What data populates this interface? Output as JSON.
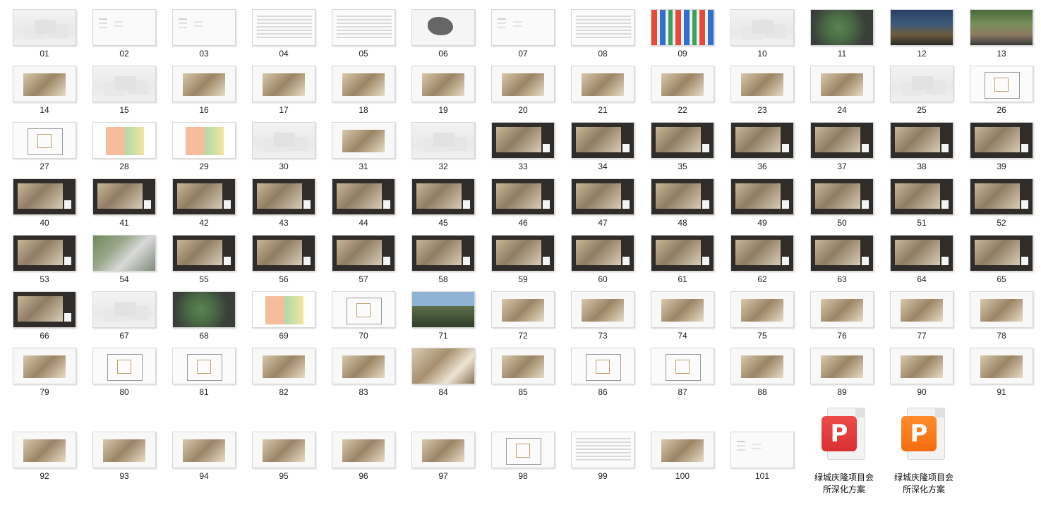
{
  "thumbnails": [
    {
      "label": "01",
      "style": "fog"
    },
    {
      "label": "02",
      "style": "white"
    },
    {
      "label": "03",
      "style": "white"
    },
    {
      "label": "04",
      "style": "text"
    },
    {
      "label": "05",
      "style": "text"
    },
    {
      "label": "06",
      "style": "map"
    },
    {
      "label": "07",
      "style": "white"
    },
    {
      "label": "08",
      "style": "text"
    },
    {
      "label": "09",
      "style": "logos"
    },
    {
      "label": "10",
      "style": "fog"
    },
    {
      "label": "11",
      "style": "aerial"
    },
    {
      "label": "12",
      "style": "night"
    },
    {
      "label": "13",
      "style": "court"
    },
    {
      "label": "14",
      "style": "photo-light"
    },
    {
      "label": "15",
      "style": "fog"
    },
    {
      "label": "16",
      "style": "photo-light"
    },
    {
      "label": "17",
      "style": "photo-light"
    },
    {
      "label": "18",
      "style": "photo-light"
    },
    {
      "label": "19",
      "style": "photo-light"
    },
    {
      "label": "20",
      "style": "photo-light"
    },
    {
      "label": "21",
      "style": "photo-light"
    },
    {
      "label": "22",
      "style": "photo-light"
    },
    {
      "label": "23",
      "style": "photo-light"
    },
    {
      "label": "24",
      "style": "photo-light"
    },
    {
      "label": "25",
      "style": "fog"
    },
    {
      "label": "26",
      "style": "plan"
    },
    {
      "label": "27",
      "style": "plan"
    },
    {
      "label": "28",
      "style": "color"
    },
    {
      "label": "29",
      "style": "color"
    },
    {
      "label": "30",
      "style": "fog"
    },
    {
      "label": "31",
      "style": "photo-light"
    },
    {
      "label": "32",
      "style": "fog"
    },
    {
      "label": "33",
      "style": "dark"
    },
    {
      "label": "34",
      "style": "dark"
    },
    {
      "label": "35",
      "style": "dark"
    },
    {
      "label": "36",
      "style": "dark"
    },
    {
      "label": "37",
      "style": "dark"
    },
    {
      "label": "38",
      "style": "dark"
    },
    {
      "label": "39",
      "style": "dark"
    },
    {
      "label": "40",
      "style": "dark"
    },
    {
      "label": "41",
      "style": "dark"
    },
    {
      "label": "42",
      "style": "dark"
    },
    {
      "label": "43",
      "style": "dark"
    },
    {
      "label": "44",
      "style": "dark"
    },
    {
      "label": "45",
      "style": "dark"
    },
    {
      "label": "46",
      "style": "dark"
    },
    {
      "label": "47",
      "style": "dark"
    },
    {
      "label": "48",
      "style": "dark"
    },
    {
      "label": "49",
      "style": "dark"
    },
    {
      "label": "50",
      "style": "dark"
    },
    {
      "label": "51",
      "style": "dark"
    },
    {
      "label": "52",
      "style": "dark"
    },
    {
      "label": "53",
      "style": "dark"
    },
    {
      "label": "54",
      "style": "green"
    },
    {
      "label": "55",
      "style": "dark"
    },
    {
      "label": "56",
      "style": "dark"
    },
    {
      "label": "57",
      "style": "dark"
    },
    {
      "label": "58",
      "style": "dark"
    },
    {
      "label": "59",
      "style": "dark"
    },
    {
      "label": "60",
      "style": "dark"
    },
    {
      "label": "61",
      "style": "dark"
    },
    {
      "label": "62",
      "style": "dark"
    },
    {
      "label": "63",
      "style": "dark"
    },
    {
      "label": "64",
      "style": "dark"
    },
    {
      "label": "65",
      "style": "dark"
    },
    {
      "label": "66",
      "style": "dark"
    },
    {
      "label": "67",
      "style": "fog"
    },
    {
      "label": "68",
      "style": "aerial"
    },
    {
      "label": "69",
      "style": "color"
    },
    {
      "label": "70",
      "style": "plan"
    },
    {
      "label": "71",
      "style": "green2"
    },
    {
      "label": "72",
      "style": "photo-light"
    },
    {
      "label": "73",
      "style": "photo-light"
    },
    {
      "label": "74",
      "style": "photo-light"
    },
    {
      "label": "75",
      "style": "photo-light"
    },
    {
      "label": "76",
      "style": "photo-light"
    },
    {
      "label": "77",
      "style": "photo-light"
    },
    {
      "label": "78",
      "style": "photo-light"
    },
    {
      "label": "79",
      "style": "photo-light"
    },
    {
      "label": "80",
      "style": "plan"
    },
    {
      "label": "81",
      "style": "plan"
    },
    {
      "label": "82",
      "style": "photo-light"
    },
    {
      "label": "83",
      "style": "photo-light"
    },
    {
      "label": "84",
      "style": "photo"
    },
    {
      "label": "85",
      "style": "photo-light"
    },
    {
      "label": "86",
      "style": "plan"
    },
    {
      "label": "87",
      "style": "plan"
    },
    {
      "label": "88",
      "style": "photo-light"
    },
    {
      "label": "89",
      "style": "photo-light"
    },
    {
      "label": "90",
      "style": "photo-light"
    },
    {
      "label": "91",
      "style": "photo-light"
    },
    {
      "label": "92",
      "style": "photo-light"
    },
    {
      "label": "93",
      "style": "photo-light"
    },
    {
      "label": "94",
      "style": "photo-light"
    },
    {
      "label": "95",
      "style": "photo-light"
    },
    {
      "label": "96",
      "style": "photo-light"
    },
    {
      "label": "97",
      "style": "photo-light"
    },
    {
      "label": "98",
      "style": "plan"
    },
    {
      "label": "99",
      "style": "text"
    },
    {
      "label": "100",
      "style": "photo-light"
    },
    {
      "label": "101",
      "style": "white"
    }
  ],
  "files": [
    {
      "name_line1": "绿城庆隆项目会",
      "name_line2": "所深化方案",
      "icon": "wps-presentation-icon",
      "color": "#e0383a"
    },
    {
      "name_line1": "绿城庆隆项目会",
      "name_line2": "所深化方案",
      "icon": "wps-presentation-icon",
      "color": "#f5781d"
    }
  ]
}
